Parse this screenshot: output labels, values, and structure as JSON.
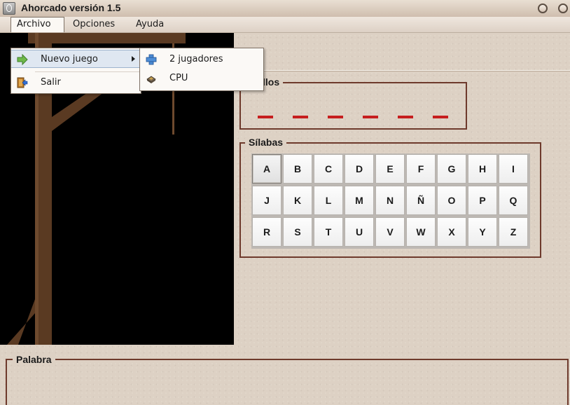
{
  "window": {
    "title": "Ahorcado versión 1.5"
  },
  "menubar": {
    "items": [
      {
        "label": "Archivo",
        "active": true
      },
      {
        "label": "Opciones",
        "active": false
      },
      {
        "label": "Ayuda",
        "active": false
      }
    ]
  },
  "archivo_menu": {
    "items": [
      {
        "label": "Nuevo juego",
        "icon": "green-arrow-icon",
        "has_submenu": true,
        "highlighted": true
      },
      {
        "label": "Salir",
        "icon": "exit-door-icon",
        "has_submenu": false,
        "highlighted": false
      }
    ]
  },
  "nuevo_juego_submenu": {
    "items": [
      {
        "label": "2 jugadores",
        "icon": "plus-icon"
      },
      {
        "label": "CPU",
        "icon": "cpu-chip-icon"
      }
    ]
  },
  "fallos": {
    "title": "Fallos",
    "visible_title": "llos",
    "dash_count": 6
  },
  "silabas": {
    "title": "Sílabas",
    "rows": [
      [
        "A",
        "B",
        "C",
        "D",
        "E",
        "F",
        "G",
        "H",
        "I"
      ],
      [
        "J",
        "K",
        "L",
        "M",
        "N",
        "Ñ",
        "O",
        "P",
        "Q"
      ],
      [
        "R",
        "S",
        "T",
        "U",
        "V",
        "W",
        "X",
        "Y",
        "Z"
      ]
    ],
    "focused_key": "A"
  },
  "palabra": {
    "title": "Palabra"
  },
  "colors": {
    "groupbox_border": "#6e3a2c",
    "dash": "#c61e1e",
    "canvas_background": "#000000",
    "gallows_wood": "#5a3a22",
    "menu_highlight": "#dfe7f1"
  }
}
